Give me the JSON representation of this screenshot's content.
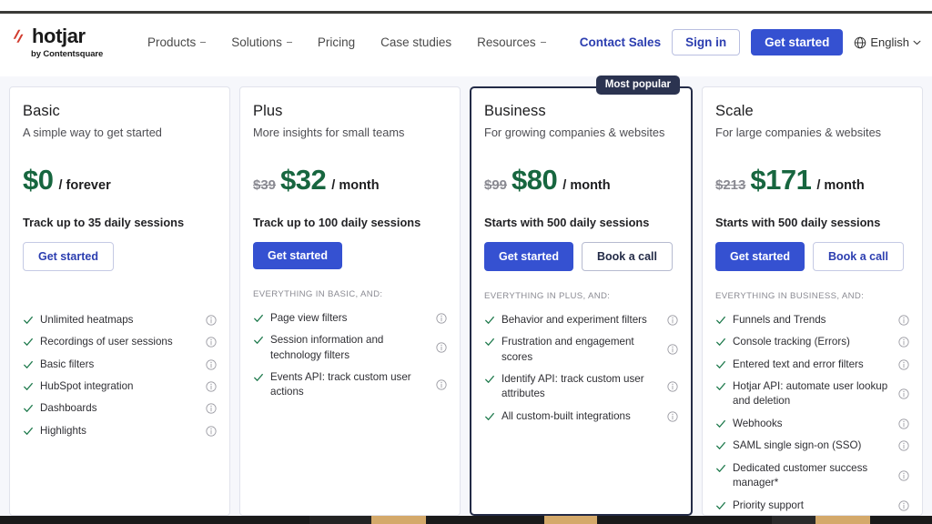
{
  "header": {
    "logo": {
      "word": "hotjar",
      "sub": "by Contentsquare",
      "mark": "hotjar-flame-icon"
    },
    "nav": [
      {
        "label": "Products",
        "has_dropdown": true
      },
      {
        "label": "Solutions",
        "has_dropdown": true
      },
      {
        "label": "Pricing",
        "has_dropdown": false
      },
      {
        "label": "Case studies",
        "has_dropdown": false
      },
      {
        "label": "Resources",
        "has_dropdown": true
      }
    ],
    "contact_sales": "Contact Sales",
    "sign_in": "Sign in",
    "get_started": "Get started",
    "language": "English"
  },
  "badge": {
    "most_popular": "Most popular"
  },
  "plans": [
    {
      "name": "Basic",
      "tagline": "A simple way to get started",
      "price_old": "",
      "price_now": "$0",
      "price_period": "/ forever",
      "sessions": "Track up to 35 daily sessions",
      "cta_primary": "Get started",
      "cta_secondary": "",
      "everything_label": "",
      "features": [
        "Unlimited heatmaps",
        "Recordings of user sessions",
        "Basic filters",
        "HubSpot integration",
        "Dashboards",
        "Highlights"
      ]
    },
    {
      "name": "Plus",
      "tagline": "More insights for small teams",
      "price_old": "$39",
      "price_now": "$32",
      "price_period": "/ month",
      "sessions": "Track up to 100 daily sessions",
      "cta_primary": "Get started",
      "cta_secondary": "",
      "everything_label": "EVERYTHING IN BASIC, AND:",
      "features": [
        "Page view filters",
        "Session information and technology filters",
        "Events API: track custom user actions"
      ]
    },
    {
      "name": "Business",
      "tagline": "For growing companies & websites",
      "price_old": "$99",
      "price_now": "$80",
      "price_period": "/ month",
      "sessions": "Starts with 500 daily sessions",
      "cta_primary": "Get started",
      "cta_secondary": "Book a call",
      "everything_label": "EVERYTHING IN PLUS, AND:",
      "features": [
        "Behavior and experiment filters",
        "Frustration and engagement scores",
        "Identify API: track custom user attributes",
        "All custom-built integrations"
      ]
    },
    {
      "name": "Scale",
      "tagline": "For large companies & websites",
      "price_old": "$213",
      "price_now": "$171",
      "price_period": "/ month",
      "sessions": "Starts with 500 daily sessions",
      "cta_primary": "Get started",
      "cta_secondary": "Book a call",
      "everything_label": "EVERYTHING IN BUSINESS, AND:",
      "features": [
        "Funnels and Trends",
        "Console tracking (Errors)",
        "Entered text and error filters",
        "Hotjar API: automate user lookup and deletion",
        "Webhooks",
        "SAML single sign-on (SSO)",
        "Dedicated customer success manager*",
        "Priority support"
      ]
    }
  ],
  "colors": {
    "brand_blue": "#3551d1",
    "link_blue": "#2c3eb0",
    "price_green": "#17663f",
    "badge_navy": "#2b3350",
    "page_bg": "#f6f7fb",
    "logo_red": "#d13b2e"
  }
}
